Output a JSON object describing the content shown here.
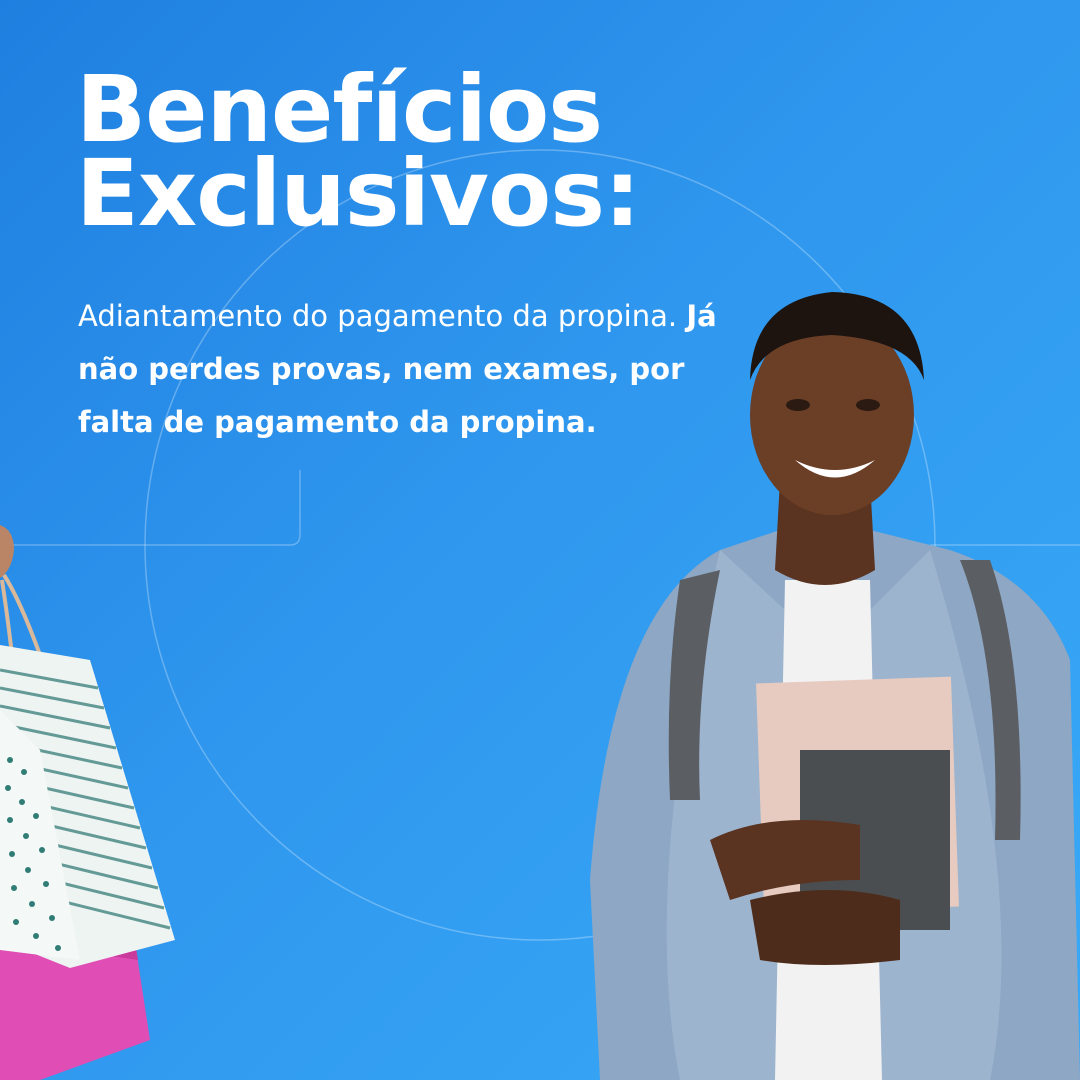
{
  "headline": {
    "line1": "Benefícios",
    "line2": "Exclusivos:"
  },
  "description": {
    "regular": "Adiantamento do pagamento da propina. ",
    "bold": "Já não perdes provas, nem exames, por falta de pagamento da propina."
  },
  "colors": {
    "background_start": "#1f7fe0",
    "background_end": "#39aaf7",
    "text": "#ffffff"
  },
  "images": {
    "student": "smiling-student-holding-books",
    "bags": "hand-holding-shopping-bags"
  }
}
